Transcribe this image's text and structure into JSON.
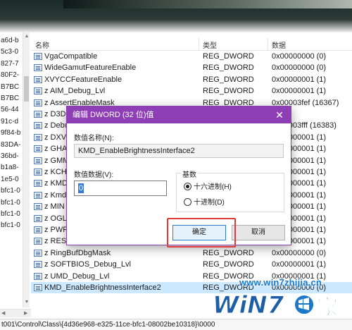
{
  "tree": {
    "items": [
      "a6d-b",
      "5c3-0",
      "827-7",
      "80F2-",
      "B7BC",
      "B7BC",
      "56-44",
      "91c-d",
      "9f84-b",
      "83DA-",
      "36bd-",
      "b1a8-",
      "1e5-0",
      "bfc1-0",
      "bfc1-0",
      "bfc1-0",
      "bfc1-0"
    ]
  },
  "list": {
    "headers": {
      "name": "名称",
      "type": "类型",
      "data": "数据"
    },
    "rows": [
      {
        "name": "VgaCompatible",
        "type": "REG_DWORD",
        "data": "0x00000000 (0)"
      },
      {
        "name": "WideGamutFeatureEnable",
        "type": "REG_DWORD",
        "data": "0x00000000 (0)"
      },
      {
        "name": "XVYCCFeatureEnable",
        "type": "REG_DWORD",
        "data": "0x00000001 (1)"
      },
      {
        "name": "z AIM_Debug_Lvl",
        "type": "REG_DWORD",
        "data": "0x00000001 (1)"
      },
      {
        "name": "z AssertEnableMask",
        "type": "REG_DWORD",
        "data": "0x00003fef (16367)"
      },
      {
        "name": "z D3D",
        "type": "REG_DWORD",
        "data": ""
      },
      {
        "name": "z Debu",
        "type": "",
        "data": "0x00003fff (16383)"
      },
      {
        "name": "z DXV",
        "type": "",
        "data": "0x00000001 (1)"
      },
      {
        "name": "z GHA",
        "type": "",
        "data": "0x00000001 (1)"
      },
      {
        "name": "z GMM",
        "type": "",
        "data": "0x00000001 (1)"
      },
      {
        "name": "z KCH",
        "type": "",
        "data": "0x00000001 (1)"
      },
      {
        "name": "z KMD",
        "type": "",
        "data": "0x00000001 (1)"
      },
      {
        "name": "z Kmd",
        "type": "",
        "data": "0x00000001 (1)"
      },
      {
        "name": "z MIN",
        "type": "",
        "data": "0x00000001 (1)"
      },
      {
        "name": "z OGL",
        "type": "",
        "data": "0x00000001 (1)"
      },
      {
        "name": "z PWR",
        "type": "",
        "data": "0x00000001 (1)"
      },
      {
        "name": "z RESOURCEMANAGER_Debug_Lvl",
        "type": "REG_DWORD",
        "data": "0x00000001 (1)"
      },
      {
        "name": "z RingBufDbgMask",
        "type": "REG_DWORD",
        "data": "0x00000000 (0)"
      },
      {
        "name": "z SOFTBIOS_Debug_Lvl",
        "type": "REG_DWORD",
        "data": "0x00000001 (1)"
      },
      {
        "name": "z UMD_Debug_Lvl",
        "type": "REG_DWORD",
        "data": "0x00000001 (1)"
      },
      {
        "name": "KMD_EnableBrightnessInterface2",
        "type": "REG_DWORD",
        "data": "0x00000000 (0)"
      }
    ],
    "selected_index": 20
  },
  "statusbar": {
    "path": "t001\\Control\\Class\\{4d36e968-e325-11ce-bfc1-08002be10318}\\0000"
  },
  "dialog": {
    "title": "编辑 DWORD (32 位)值",
    "value_name_label": "数值名称(N):",
    "value_name": "KMD_EnableBrightnessInterface2",
    "value_data_label": "数值数据(V):",
    "value_data": "0",
    "base_label": "基数",
    "hex_label": "十六进制(H)",
    "dec_label": "十进制(D)",
    "selected_base": "hex",
    "ok_label": "确定",
    "cancel_label": "取消",
    "close_glyph": "✕"
  },
  "watermark": {
    "url": "www.win7zhijia.cn"
  },
  "colors": {
    "dialog_title": "#8e3fb6",
    "selection": "#cce8ff",
    "highlight_box": "#e03a3a",
    "watermark": "#1c78c8"
  }
}
